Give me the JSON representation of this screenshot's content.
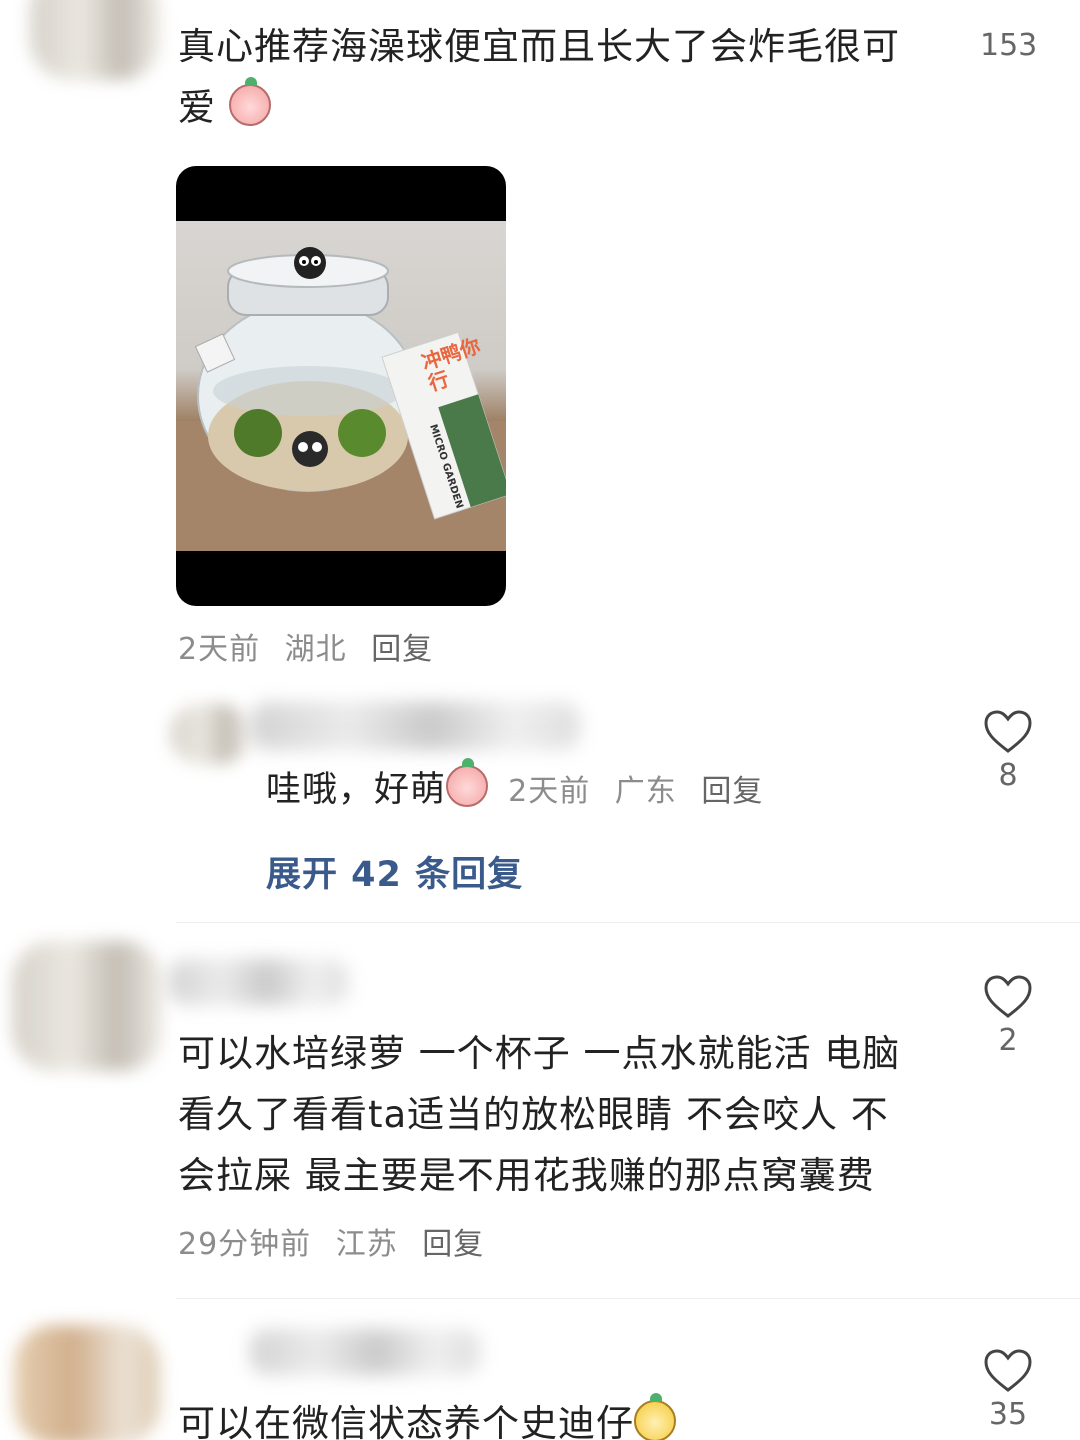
{
  "comments": [
    {
      "text_line1": "真心推荐海澡球便宜而且长大了会炸毛很可",
      "text_line2": "爱",
      "emoji_icon": "shy-face-emoji",
      "time": "2天前",
      "location": "湖北",
      "reply_label": "回复",
      "like_count": "153",
      "photo_sign_text": "冲鸭你行",
      "photo_card_text": "MICRO GARDEN"
    },
    {
      "text": "哇哦，好萌",
      "emoji_icon": "surprised-face-emoji",
      "time": "2天前",
      "location": "广东",
      "reply_label": "回复",
      "like_count": "8",
      "expand_label": "展开 42 条回复"
    },
    {
      "text_line1": "可以水培绿萝 一个杯子 一点水就能活 电脑",
      "text_line2": "看久了看看ta适当的放松眼睛 不会咬人 不",
      "text_line3": "会拉屎 最主要是不用花我赚的那点窝囊费",
      "time": "29分钟前",
      "location": "江苏",
      "reply_label": "回复",
      "like_count": "2"
    },
    {
      "text": "可以在微信状态养个史迪仔",
      "emoji_icon": "yellow-face-emoji",
      "like_count": "35"
    }
  ],
  "colors": {
    "text": "#222222",
    "meta": "#8c8c8c",
    "expand_link": "#3a5a8c",
    "divider": "#ececec"
  }
}
